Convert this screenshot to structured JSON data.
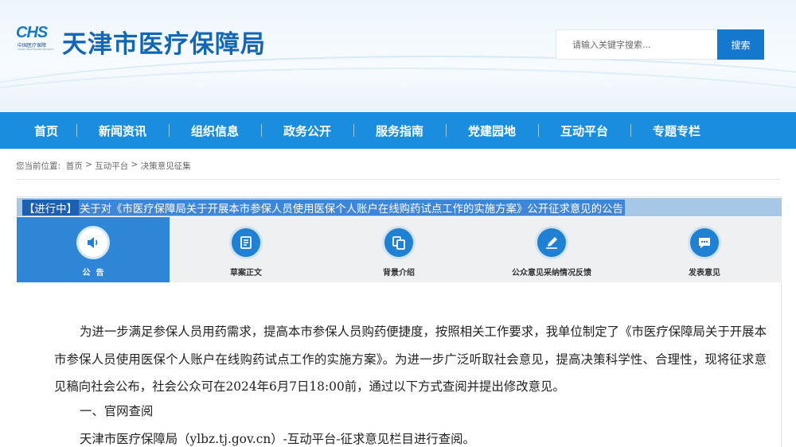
{
  "header": {
    "logo_text": "CHS",
    "logo_org": "中国医疗保障",
    "logo_sub": "CHINA HEALTHCARE SECURITY",
    "title": "天津市医疗保障局",
    "search_placeholder": "请输入关键字搜索...",
    "search_button": "搜索"
  },
  "nav": [
    "首页",
    "新闻资讯",
    "组织信息",
    "政务公开",
    "服务指南",
    "党建园地",
    "互动平台",
    "专题专栏"
  ],
  "breadcrumb": {
    "prefix": "您当前位置:",
    "items": [
      "首页",
      "互动平台",
      "决策意见征集"
    ],
    "separator": " > "
  },
  "notice": {
    "status": "【进行中】",
    "title": "关于对《市医疗保障局关于开展本市参保人员使用医保个人账户在线购药试点工作的实施方案》公开征求意见的公告"
  },
  "tabs": [
    {
      "label": "公  告",
      "icon": "speaker-icon",
      "active": true
    },
    {
      "label": "草案正文",
      "icon": "document-icon",
      "active": false
    },
    {
      "label": "背景介绍",
      "icon": "copy-icon",
      "active": false
    },
    {
      "label": "公众意见采纳情况反馈",
      "icon": "edit-icon",
      "active": false
    },
    {
      "label": "发表意见",
      "icon": "chat-icon",
      "active": false
    }
  ],
  "content": {
    "paragraph": "为进一步满足参保人员用药需求，提高本市参保人员购药便捷度，按照相关工作要求，我单位制定了《市医疗保障局关于开展本市参保人员使用医保个人账户在线购药试点工作的实施方案》。为进一步广泛听取社会意见，提高决策科学性、合理性，现将征求意见稿向社会公布，社会公众可在2024年6月7日18:00前，通过以下方式查阅并提出修改意见。",
    "heading1": "一、官网查阅",
    "paragraph2": "天津市医疗保障局（ylbz.tj.gov.cn）-互动平台-征求意见栏目进行查阅。"
  },
  "colors": {
    "nav_bg": "#1a8ddf",
    "title_color": "#1366b3",
    "active_tab": "#2f86d6",
    "search_button": "#1478cf"
  }
}
